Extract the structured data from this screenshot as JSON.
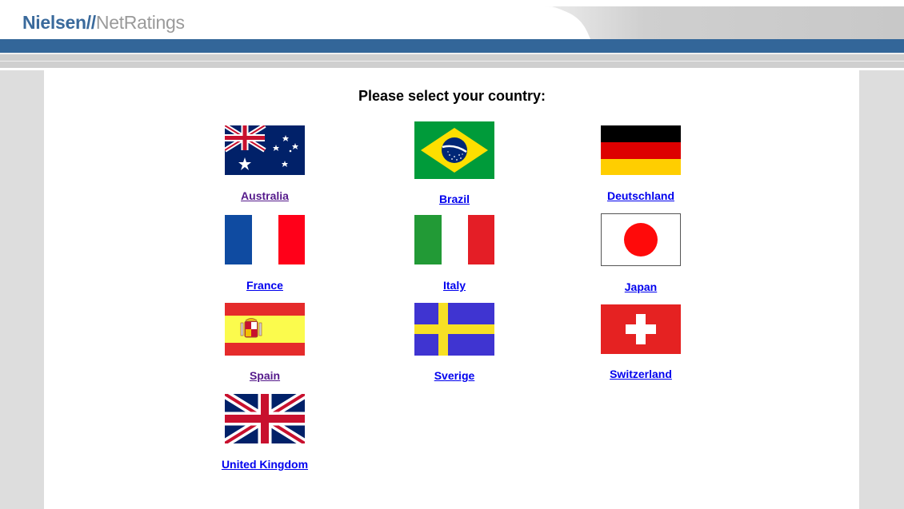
{
  "header": {
    "logo_primary": "Nielsen//",
    "logo_secondary": "NetRatings"
  },
  "main": {
    "title": "Please select your country:"
  },
  "countries": [
    {
      "label": " Australia",
      "flag": "australia-flag-icon",
      "visited": true
    },
    {
      "label": "Brazil",
      "flag": "brazil-flag-icon",
      "visited": false
    },
    {
      "label": "Deutschland",
      "flag": "germany-flag-icon",
      "visited": false
    },
    {
      "label": "France",
      "flag": "france-flag-icon",
      "visited": false
    },
    {
      "label": "Italy",
      "flag": "italy-flag-icon",
      "visited": false
    },
    {
      "label": "Japan",
      "flag": "japan-flag-icon",
      "visited": false
    },
    {
      "label": "Spain",
      "flag": "spain-flag-icon",
      "visited": true
    },
    {
      "label": "Sverige",
      "flag": "sweden-flag-icon",
      "visited": false
    },
    {
      "label": "Switzerland",
      "flag": "switzerland-flag-icon",
      "visited": false
    },
    {
      "label": "United Kingdom",
      "flag": "uk-flag-icon",
      "visited": false
    }
  ],
  "colors": {
    "brand_blue": "#336699",
    "link_unvisited": "#0000ee",
    "link_visited": "#551a8b"
  }
}
